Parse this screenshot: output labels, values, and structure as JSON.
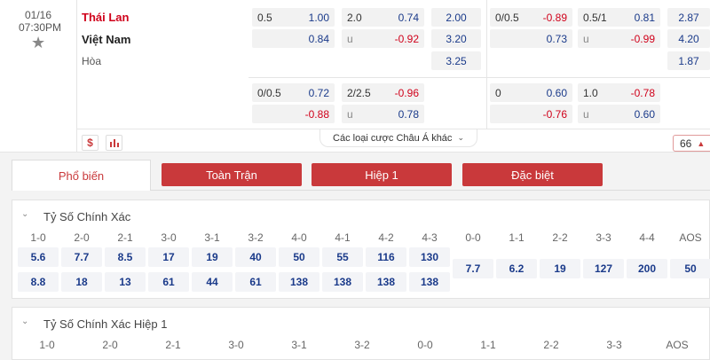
{
  "match": {
    "date": "01/16",
    "time": "07:30PM",
    "home": "Thái Lan",
    "away": "Việt Nam",
    "draw": "Hòa"
  },
  "odds_row1": {
    "ah": {
      "line": "0.5",
      "home": "1.00",
      "away": "0.84"
    },
    "ou": {
      "line": "2.0",
      "over": "0.74",
      "u": "u",
      "under": "-0.92"
    },
    "x12": {
      "home": "2.00",
      "away": "3.20",
      "draw": "3.25"
    },
    "ah_h1": {
      "line": "0/0.5",
      "home": "-0.89",
      "away": "0.73"
    },
    "ou_h1": {
      "line": "0.5/1",
      "over": "0.81",
      "u": "u",
      "under": "-0.99"
    },
    "x12_h1": {
      "home": "2.87",
      "away": "4.20",
      "draw": "1.87"
    }
  },
  "odds_row2": {
    "ah": {
      "line": "0/0.5",
      "home": "0.72",
      "away": "-0.88"
    },
    "ou": {
      "line": "2/2.5",
      "over": "-0.96",
      "u": "u",
      "under": "0.78"
    },
    "ah_h1": {
      "line": "0",
      "home": "0.60",
      "away": "-0.76"
    },
    "ou_h1": {
      "line": "1.0",
      "over": "-0.78",
      "u": "u",
      "under": "0.60"
    }
  },
  "more_markets": "Các loại cược Châu Á khác",
  "more_count": "66",
  "tabs": [
    "Phổ biến",
    "Toàn Trận",
    "Hiệp 1",
    "Đặc biệt"
  ],
  "correct_score": {
    "title": "Tỷ Số Chính Xác",
    "home_headers": [
      "1-0",
      "2-0",
      "2-1",
      "3-0",
      "3-1",
      "3-2",
      "4-0",
      "4-1",
      "4-2",
      "4-3"
    ],
    "home_odds": [
      "5.6",
      "7.7",
      "8.5",
      "17",
      "19",
      "40",
      "50",
      "55",
      "116",
      "130"
    ],
    "away_odds": [
      "8.8",
      "18",
      "13",
      "61",
      "44",
      "61",
      "138",
      "138",
      "138",
      "138"
    ],
    "draw_headers": [
      "0-0",
      "1-1",
      "2-2",
      "3-3",
      "4-4",
      "AOS"
    ],
    "draw_odds": [
      "7.7",
      "6.2",
      "19",
      "127",
      "200",
      "50"
    ]
  },
  "correct_score_h1": {
    "title": "Tỷ Số Chính Xác Hiệp 1",
    "headers": [
      "1-0",
      "2-0",
      "2-1",
      "3-0",
      "3-1",
      "3-2",
      "0-0",
      "1-1",
      "2-2",
      "3-3",
      "AOS"
    ]
  }
}
